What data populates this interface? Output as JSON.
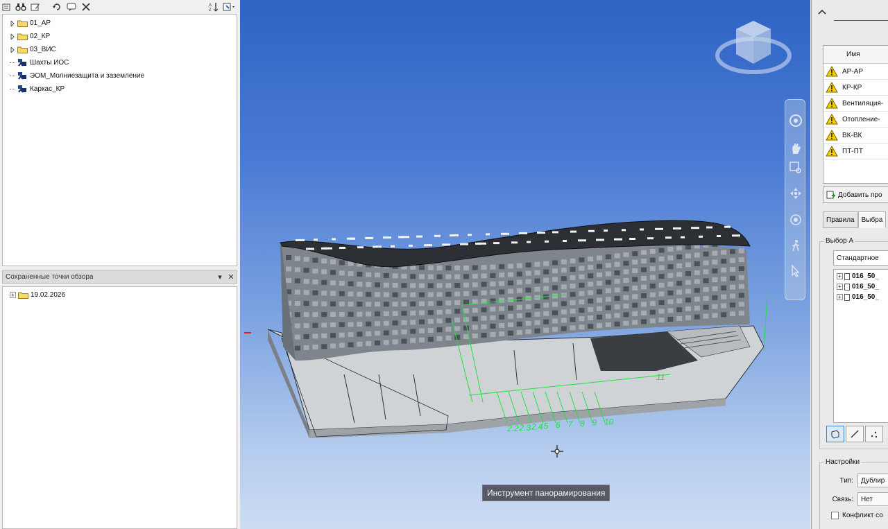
{
  "left_panel": {
    "tree_items": [
      {
        "label": "01_АР",
        "type": "folder"
      },
      {
        "label": "02_КР",
        "type": "folder"
      },
      {
        "label": "03_ВИС",
        "type": "folder"
      },
      {
        "label": "Шахты ИОС",
        "type": "model"
      },
      {
        "label": "ЭОМ_Молниезащита и заземление",
        "type": "model"
      },
      {
        "label": "Каркас_КР",
        "type": "model"
      }
    ],
    "saved_views": {
      "title": "Сохраненные точки обзора",
      "items": [
        {
          "label": "19.02.2026",
          "type": "folder"
        }
      ]
    }
  },
  "viewport": {
    "tooltip": "Инструмент панорамирования",
    "viewcube_label": "ViewCube",
    "grid_labels_bottom": [
      "2.2",
      "2.3",
      "2.4",
      "5",
      "6",
      "7",
      "8",
      "9",
      "10"
    ],
    "grid_label_right": "11"
  },
  "right_panel": {
    "table_header": "Имя",
    "tests": [
      {
        "label": "АР-АР"
      },
      {
        "label": "КР-КР"
      },
      {
        "label": "Вентиляция-"
      },
      {
        "label": "Отопление-"
      },
      {
        "label": "ВК-ВК"
      },
      {
        "label": "ПТ-ПТ"
      }
    ],
    "add_button": "Добавить про",
    "tabs": [
      {
        "label": "Правила",
        "active": false
      },
      {
        "label": "Выбра",
        "active": true
      }
    ],
    "selection_group": "Выбор А",
    "selection_combo": "Стандартное",
    "selection_items": [
      "016_50_",
      "016_50_",
      "016_50_"
    ],
    "settings": {
      "title": "Настройки",
      "type_label": "Тип:",
      "type_value": "Дублир",
      "links_label": "Связь:",
      "links_value": "Нет",
      "conflict_label": "Конфликт со"
    }
  },
  "colors": {
    "viewport_top": "#2f64c4",
    "viewport_bottom": "#cddcf3",
    "grid_green": "#22e040",
    "warning_yellow": "#f5d000"
  }
}
